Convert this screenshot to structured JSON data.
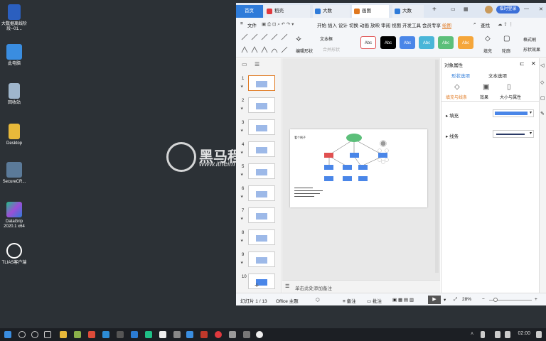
{
  "desktop": {
    "icons": [
      {
        "label": "大数据离线阶段--01...",
        "icon": "word-doc-icon",
        "color": "#2b5fbf"
      },
      {
        "label": "此电脑",
        "icon": "computer-icon",
        "color": "#3a8de0"
      },
      {
        "label": "回收站",
        "icon": "recycle-bin-icon",
        "color": "#9fb6cc"
      },
      {
        "label": "Desktop",
        "icon": "folder-icon",
        "color": "#e8b93a"
      },
      {
        "label": "SecureCR...",
        "icon": "securecrt-icon",
        "color": "#5b7a99"
      },
      {
        "label": "DataGrip 2020.1 x64",
        "icon": "datagrip-icon",
        "color": "#1fbf86"
      },
      {
        "label": "TLIAS客户端",
        "icon": "tlias-icon",
        "color": "#ffffff"
      }
    ],
    "watermark": {
      "text": "黑马程",
      "url": "www.itheim"
    }
  },
  "window": {
    "tabs": [
      {
        "label": "首页",
        "icon": "home-icon",
        "color": "#2e7bd9"
      },
      {
        "label": "稻壳",
        "icon": "daoke-icon",
        "color": "#e0393e"
      },
      {
        "label": "大数",
        "icon": "doc-icon",
        "color": "#2e7bd9"
      },
      {
        "label": "画图",
        "icon": "ppt-icon",
        "color": "#e0781f"
      },
      {
        "label": "大数",
        "icon": "doc-icon",
        "color": "#2e7bd9"
      }
    ],
    "add_tab": "+",
    "login_label": "临时登录",
    "menu": {
      "file": "文件",
      "items": [
        "开始",
        "插入",
        "设计",
        "切换",
        "动画",
        "放映",
        "审阅",
        "视图",
        "开发工具",
        "会员专享",
        "绘图"
      ],
      "search": "查找"
    },
    "ribbon": {
      "edit_shape": "编辑形状",
      "text_box": "文本框",
      "merge_shape": "合并形状",
      "styles": [
        {
          "label": "Abc",
          "bg": "#ffffff",
          "fg": "#333333",
          "border": "#e05050"
        },
        {
          "label": "Abc",
          "bg": "#000000",
          "fg": "#ffffff",
          "border": "#000000"
        },
        {
          "label": "Abc",
          "bg": "#4a86e8",
          "fg": "#ffffff",
          "border": "#4a86e8"
        },
        {
          "label": "Abc",
          "bg": "#4ab6d8",
          "fg": "#ffffff",
          "border": "#4ab6d8"
        },
        {
          "label": "Abc",
          "bg": "#5cbf7a",
          "fg": "#ffffff",
          "border": "#5cbf7a"
        },
        {
          "label": "Abc",
          "bg": "#f5a63a",
          "fg": "#ffffff",
          "border": "#f5a63a"
        }
      ],
      "fill": "填充",
      "outline": "轮廓",
      "format_painter": "格式刷",
      "shape_effect": "形状效果"
    },
    "thumbnails": [
      "1",
      "2",
      "3",
      "4",
      "5",
      "6",
      "7",
      "8",
      "9",
      "10"
    ],
    "add_slide": "+",
    "slide": {
      "title": "看个例子"
    },
    "notes_placeholder": "单击此处添加备注",
    "properties": {
      "title": "对象属性",
      "tabs": [
        "形状选项",
        "文本选项"
      ],
      "subtabs": [
        "填充与线条",
        "效果",
        "大小与属性"
      ],
      "fill_label": "填充",
      "line_label": "线条",
      "fill_color": "#4a86e8"
    },
    "status": {
      "slide_info": "幻灯片 1 / 13",
      "theme": "Office 主题",
      "notes": "备注",
      "comments": "批注",
      "zoom": "28%"
    }
  },
  "taskbar": {
    "time": "02:00"
  }
}
